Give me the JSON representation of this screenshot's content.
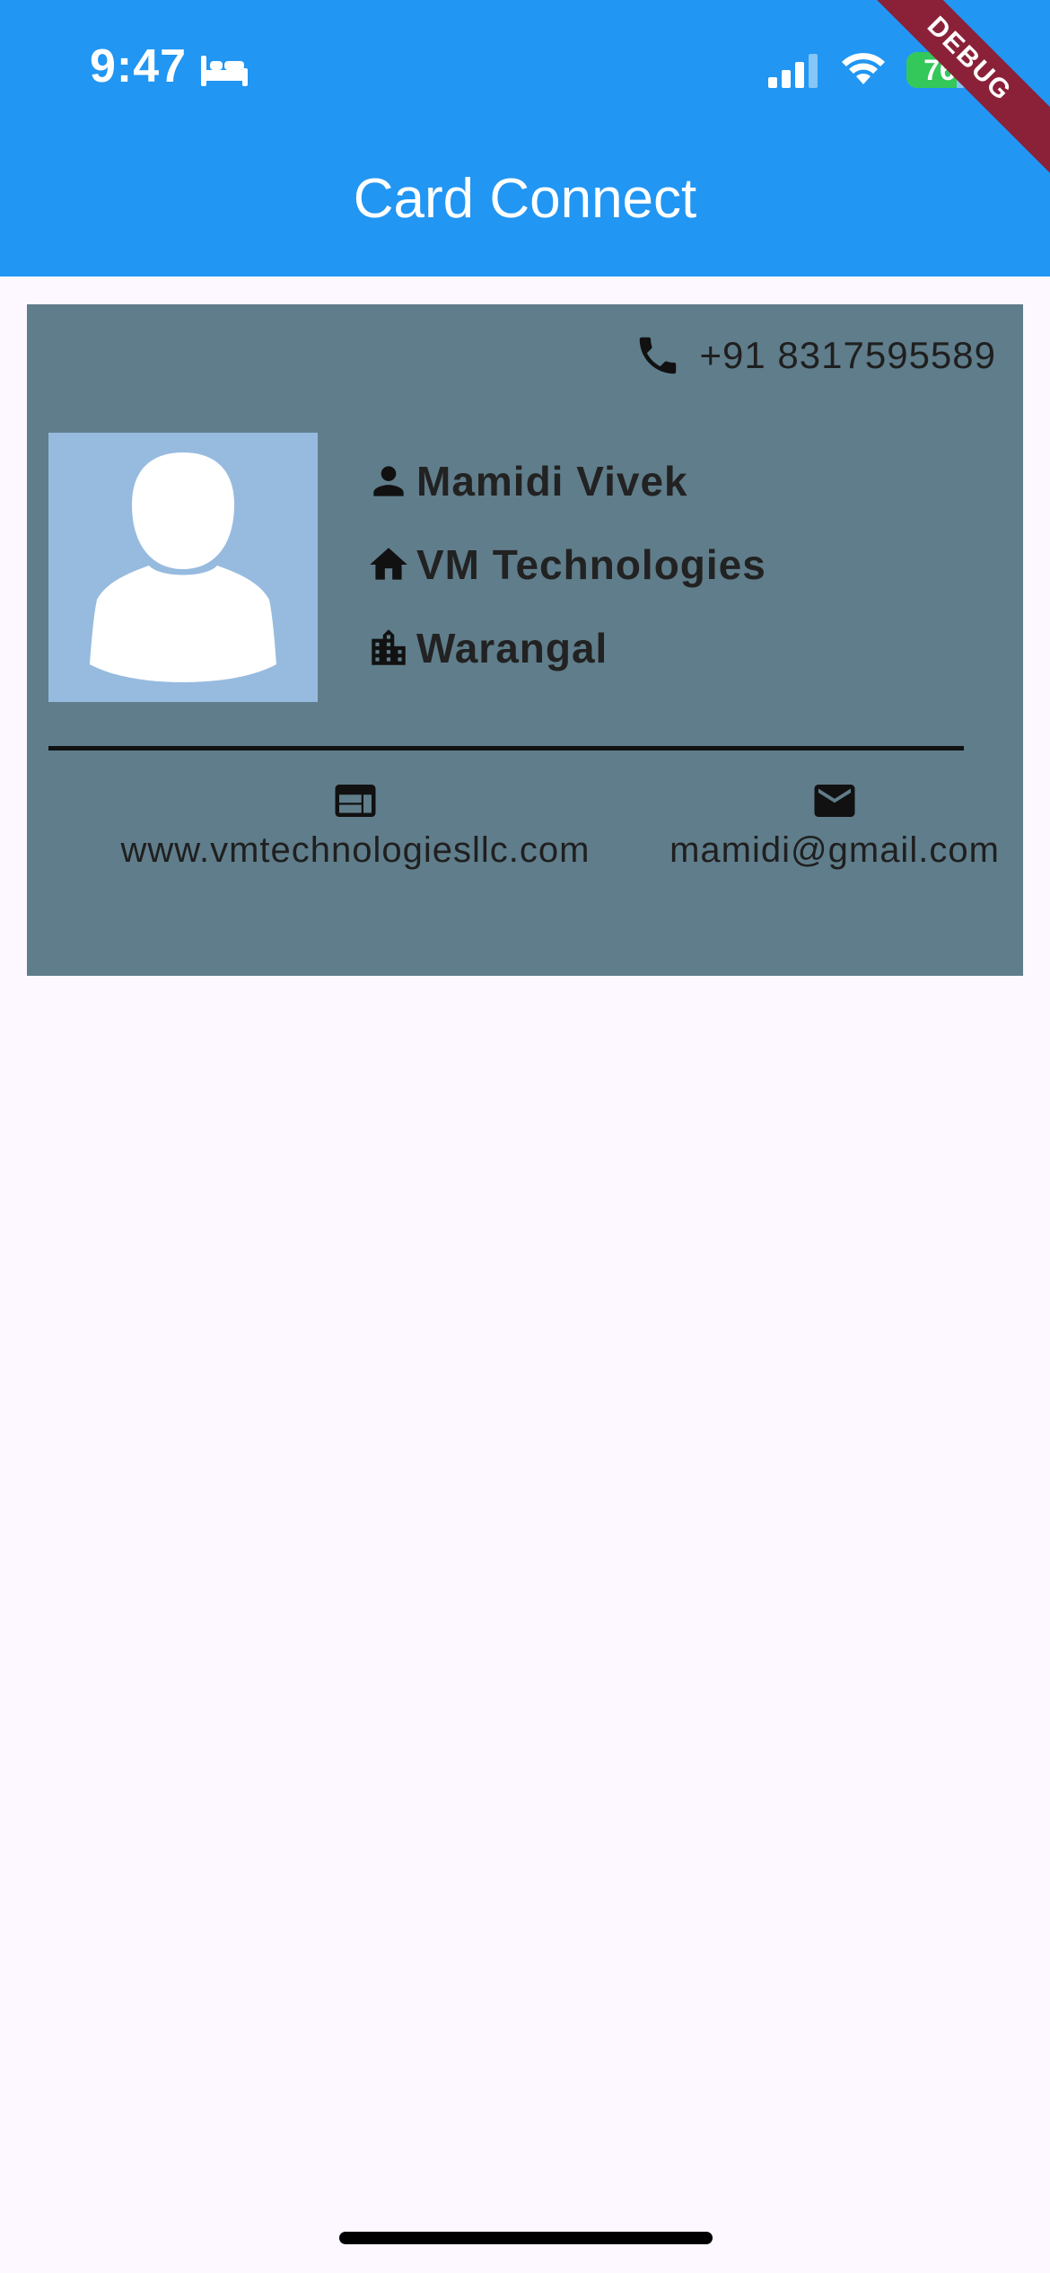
{
  "status_bar": {
    "time": "9:47",
    "battery_level": 76,
    "battery_label": "76"
  },
  "debug_banner": "DEBUG",
  "app_bar": {
    "title": "Card Connect"
  },
  "card": {
    "phone": "+91 8317595589",
    "name": "Mamidi Vivek",
    "company": "VM Technologies",
    "city": "Warangal",
    "website": "www.vmtechnologiesllc.com",
    "email": "mamidi@gmail.com",
    "icons": {
      "phone": "phone-icon",
      "name": "person-icon",
      "company": "home-icon",
      "city": "city-icon",
      "website": "web-icon",
      "email": "mail-icon"
    }
  },
  "colors": {
    "app_bar": "#2196f3",
    "card_background": "#607d8b",
    "avatar_background": "#97bbdf",
    "page_background": "#fdf7ff",
    "debug_banner": "#8b2138",
    "battery_fill": "#34c759"
  }
}
